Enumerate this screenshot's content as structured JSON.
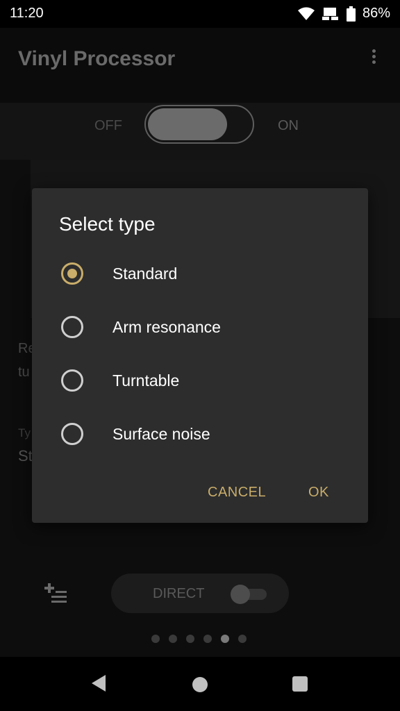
{
  "status_bar": {
    "time": "11:20",
    "battery": "86%"
  },
  "app_bar": {
    "title": "Vinyl Processor"
  },
  "power_switch": {
    "off_label": "OFF",
    "on_label": "ON"
  },
  "background_content": {
    "description_partial": "Re\ntu",
    "type_label_partial": "Ty",
    "type_value_partial": "St"
  },
  "bottom_controls": {
    "direct_label": "DIRECT"
  },
  "page_indicator": {
    "count": 6,
    "active_index": 4
  },
  "dialog": {
    "title": "Select type",
    "options": [
      {
        "label": "Standard",
        "selected": true
      },
      {
        "label": "Arm resonance",
        "selected": false
      },
      {
        "label": "Turntable",
        "selected": false
      },
      {
        "label": "Surface noise",
        "selected": false
      }
    ],
    "cancel_label": "CANCEL",
    "ok_label": "OK"
  },
  "colors": {
    "accent": "#c9ad6a",
    "dialog_bg": "#2d2d2d"
  }
}
